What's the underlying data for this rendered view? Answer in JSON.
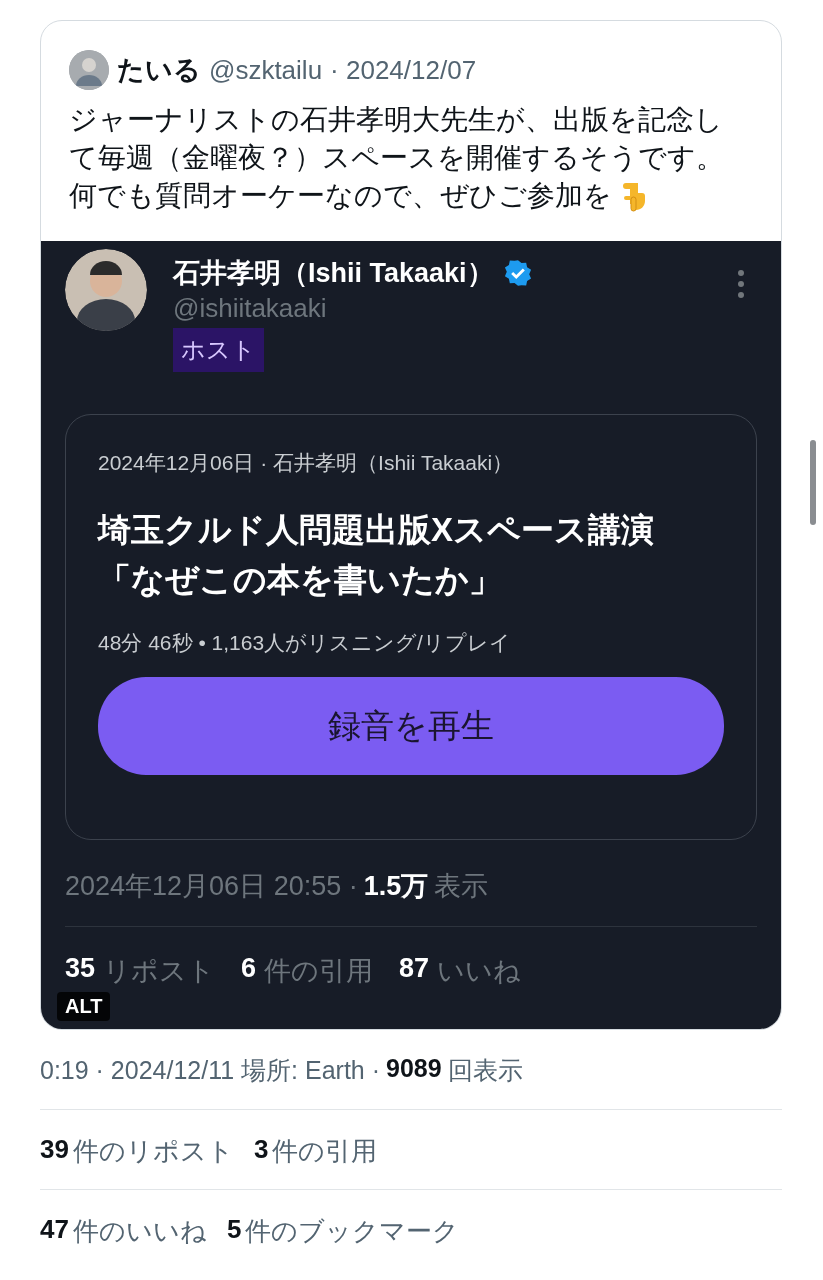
{
  "quote": {
    "author": "たいる",
    "handle": "@szktailu",
    "date": "· 2024/12/07",
    "text_lines": [
      "ジャーナリストの石井孝明大先生が、出版を記念し",
      "て毎週（金曜夜？）スペースを開催するそうです。",
      "何でも質問オーケーなので、ぜひご参加を"
    ],
    "image": {
      "host_name": "石井孝明（Ishii Takaaki）",
      "verified": true,
      "host_handle": "@ishiitakaaki",
      "role": "ホスト",
      "space": {
        "meta": "2024年12月06日 · 石井孝明（Ishii Takaaki）",
        "title_lines": [
          "埼玉クルド人問題出版Xスペース講演",
          "「なぜこの本を書いたか」"
        ],
        "stats": "48分 46秒 • 1,163人がリスニング/リプレイ",
        "button": "録音を再生"
      },
      "timestamp": "2024年12月06日 20:55 ·",
      "views_count": "1.5万",
      "views_label": "表示",
      "engagement": [
        {
          "count": "35",
          "label": "リポスト"
        },
        {
          "count": "6",
          "label": "件の引用"
        },
        {
          "count": "87",
          "label": "いいね"
        }
      ],
      "alt_badge": "ALT"
    }
  },
  "meta": {
    "text": "0:19 · 2024/12/11 場所: Earth ·",
    "views_count": "9089",
    "views_label": "回表示"
  },
  "stats_rows": [
    [
      {
        "count": "39",
        "label": "件のリポスト"
      },
      {
        "count": "3",
        "label": "件の引用"
      }
    ],
    [
      {
        "count": "47",
        "label": "件のいいね"
      },
      {
        "count": "5",
        "label": "件のブックマーク"
      }
    ]
  ]
}
